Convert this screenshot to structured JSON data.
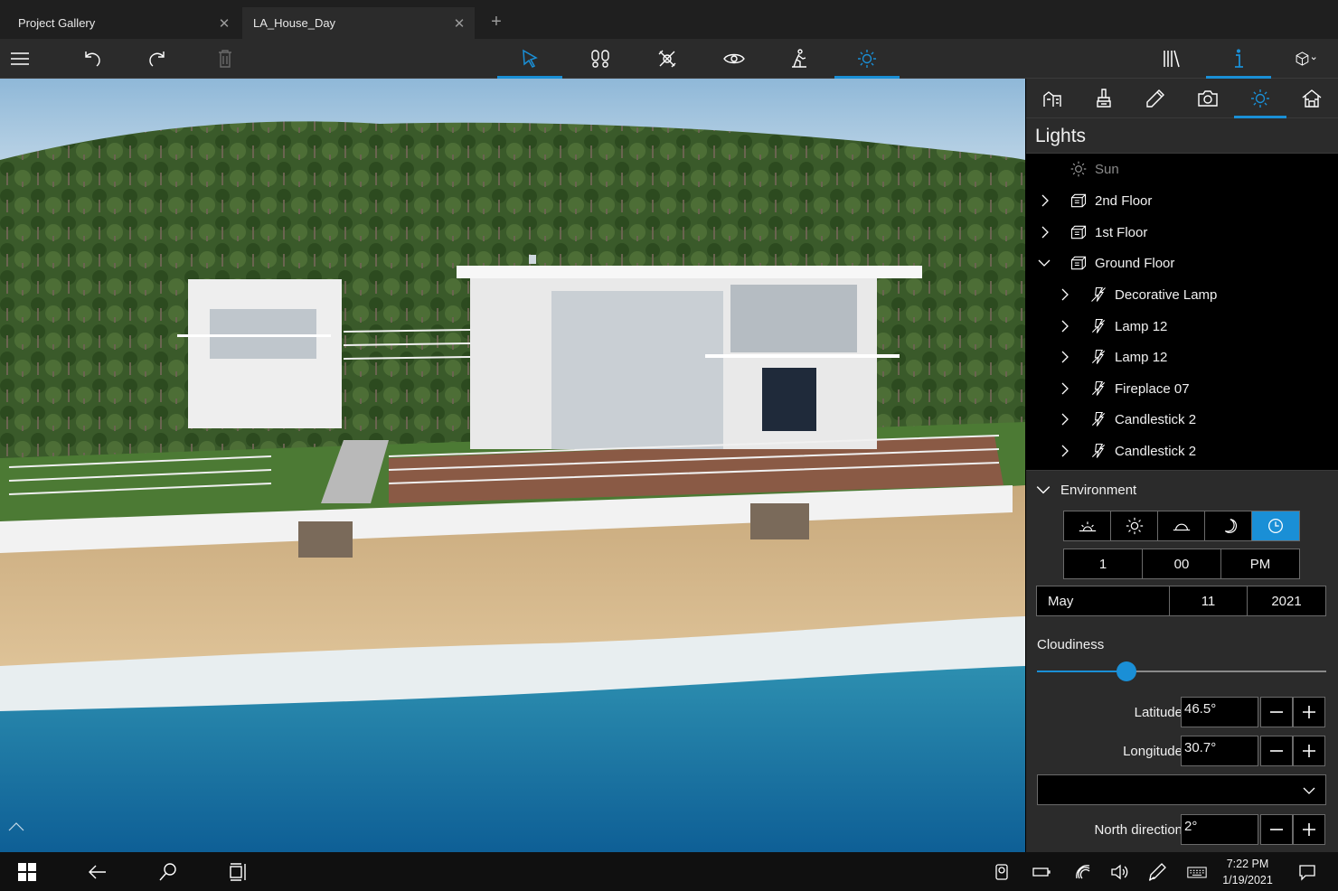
{
  "tabs": [
    {
      "label": "Project Gallery",
      "close": "✕"
    },
    {
      "label": "LA_House_Day",
      "close": "✕"
    }
  ],
  "new_tab": "+",
  "toolbar": {
    "left_icons": [
      "menu-icon",
      "undo-icon",
      "redo-icon",
      "trash-icon"
    ],
    "center_icons": [
      "select-cursor-icon",
      "footprints-icon",
      "tools-icon",
      "eye-icon",
      "walk-person-icon",
      "sun-icon"
    ],
    "active_center": "sun-icon",
    "right_icons": [
      "library-icon",
      "info-icon",
      "cube-view-icon"
    ],
    "active_right": "info-icon",
    "accent": "#1a8fd6"
  },
  "panel": {
    "tab_icons": [
      "furniture-icon",
      "paint-roller-icon",
      "pencil-icon",
      "camera-icon",
      "sun-icon",
      "house-icon"
    ],
    "active_tab": "sun-icon",
    "title": "Lights",
    "tree": [
      {
        "label": "Sun",
        "icon": "sun-icon",
        "level": 0,
        "expander": "none",
        "disabled": true
      },
      {
        "label": "2nd Floor",
        "icon": "floor-icon",
        "level": 0,
        "expander": "collapsed"
      },
      {
        "label": "1st Floor",
        "icon": "floor-icon",
        "level": 0,
        "expander": "collapsed"
      },
      {
        "label": "Ground Floor",
        "icon": "floor-icon",
        "level": 0,
        "expander": "expanded"
      },
      {
        "label": "Decorative Lamp",
        "icon": "lamp-off-icon",
        "level": 1,
        "expander": "collapsed"
      },
      {
        "label": "Lamp 12",
        "icon": "lamp-icon",
        "level": 1,
        "expander": "collapsed"
      },
      {
        "label": "Lamp 12",
        "icon": "lamp-icon",
        "level": 1,
        "expander": "collapsed"
      },
      {
        "label": "Fireplace 07",
        "icon": "lamp-icon",
        "level": 1,
        "expander": "collapsed"
      },
      {
        "label": "Candlestick 2",
        "icon": "lamp-icon",
        "level": 1,
        "expander": "collapsed"
      },
      {
        "label": "Candlestick 2",
        "icon": "lamp-icon",
        "level": 1,
        "expander": "collapsed"
      }
    ],
    "environment": {
      "header": "Environment",
      "time_presets": [
        "sunrise-icon",
        "day-sun-icon",
        "sunset-icon",
        "night-moon-icon",
        "clock-icon"
      ],
      "selected_preset": "clock-icon",
      "time": {
        "hour": "1",
        "minute": "00",
        "ampm": "PM"
      },
      "date": {
        "month": "May",
        "day": "11",
        "year": "2021"
      },
      "cloudiness_label": "Cloudiness",
      "cloudiness_value": 0.31,
      "latitude_label": "Latitude",
      "latitude": "46.5°",
      "longitude_label": "Longitude",
      "longitude": "30.7°",
      "location_dropdown": "",
      "north_label": "North direction",
      "north": "2°"
    }
  },
  "taskbar": {
    "icons": [
      "windows-start-icon",
      "back-arrow-icon",
      "search-icon",
      "task-view-icon"
    ],
    "tray_icons": [
      "people-icon",
      "battery-icon",
      "wifi-icon",
      "volume-icon",
      "pen-icon",
      "keyboard-icon",
      "notification-icon"
    ],
    "time": "7:22 PM",
    "date": "1/19/2021"
  }
}
